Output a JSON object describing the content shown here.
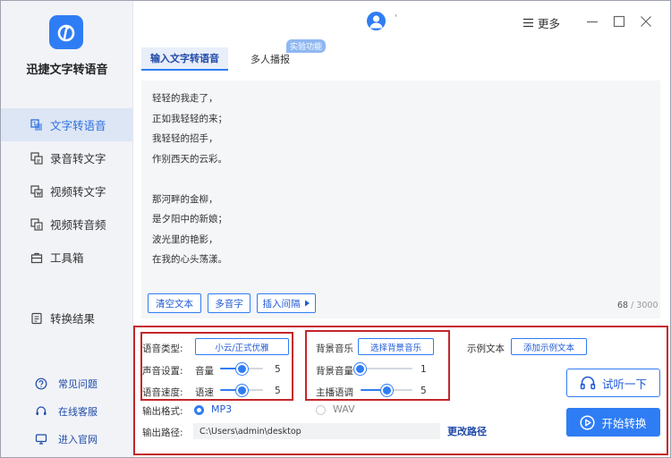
{
  "app": {
    "name": "迅捷文字转语音"
  },
  "sidebar": {
    "items": [
      {
        "label": "文字转语音",
        "icon": "text-to-speech-icon",
        "active": true
      },
      {
        "label": "录音转文字",
        "icon": "recording-to-text-icon"
      },
      {
        "label": "视频转文字",
        "icon": "video-to-text-icon"
      },
      {
        "label": "视频转音频",
        "icon": "video-to-audio-icon"
      },
      {
        "label": "工具箱",
        "icon": "toolbox-icon"
      }
    ],
    "result": {
      "label": "转换结果",
      "icon": "result-icon"
    },
    "support": [
      {
        "label": "常见问题",
        "icon": "question-icon"
      },
      {
        "label": "在线客服",
        "icon": "headset-icon"
      },
      {
        "label": "进入官网",
        "icon": "monitor-icon"
      }
    ]
  },
  "topbar": {
    "username": "'",
    "more_label": "更多"
  },
  "tabs": [
    {
      "label": "输入文字转语音",
      "active": true
    },
    {
      "label": "多人播报",
      "badge": "实验功能"
    }
  ],
  "editor": {
    "lines": [
      "轻轻的我走了，",
      "正如我轻轻的来；",
      "我轻轻的招手，",
      "作别西天的云彩。",
      "",
      "那河畔的金柳，",
      "是夕阳中的新娘；",
      "波光里的艳影，",
      "在我的心头荡漾。"
    ],
    "buttons": {
      "clear": "清空文本",
      "polyphone": "多音字",
      "insert_pause": "插入间隔"
    },
    "count": "68",
    "max": "/ 3000"
  },
  "voice": {
    "type_label": "语音类型:",
    "type_value": "小云/正式优雅",
    "sound_label": "声音设置:",
    "volume_label": "音量",
    "volume_value": "5",
    "speed_label": "语音速度:",
    "speed_sub_label": "语速",
    "speed_value": "5",
    "volume_fraction": 0.5,
    "speed_fraction": 0.5
  },
  "bgm": {
    "label": "背景音乐",
    "button": "选择背景音乐",
    "bg_volume_label": "背景音量",
    "bg_volume_value": "1",
    "anchor_label": "主播语调",
    "anchor_value": "5",
    "bg_volume_fraction": 0.0,
    "anchor_fraction": 0.5
  },
  "sample": {
    "label": "示例文本",
    "button": "添加示例文本"
  },
  "output": {
    "format_label": "输出格式:",
    "formats": [
      {
        "label": "MP3",
        "selected": true
      },
      {
        "label": "WAV",
        "selected": false
      }
    ],
    "path_label": "输出路径:",
    "path_value": "C:\\Users\\admin\\desktop",
    "change_path": "更改路径"
  },
  "actions": {
    "listen": "试听一下",
    "start": "开始转换"
  },
  "colors": {
    "accent": "#2f7df4",
    "highlight_border": "#c4262b",
    "sidebar_bg": "#f1f3f7",
    "active_nav_bg": "#dde6f5"
  }
}
